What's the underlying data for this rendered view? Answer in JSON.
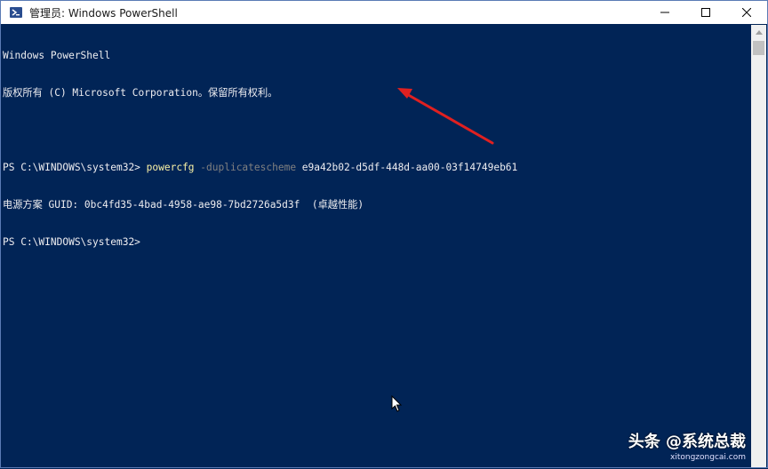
{
  "window": {
    "title": "管理员: Windows PowerShell"
  },
  "console": {
    "banner1": "Windows PowerShell",
    "banner2": "版权所有 (C) Microsoft Corporation。保留所有权利。",
    "prompt1": "PS C:\\WINDOWS\\system32> ",
    "cmd": "powercfg",
    "param": " -duplicatescheme",
    "arg": " e9a42b02-d5df-448d-aa00-03f14749eb61",
    "output": "电源方案 GUID: 0bc4fd35-4bad-4958-ae98-7bd2726a5d3f  (卓越性能)",
    "prompt2": "PS C:\\WINDOWS\\system32>"
  },
  "watermark": {
    "main": "头条 @系统总裁",
    "sub": "xitongzongcai.com"
  },
  "colors": {
    "console_bg": "#012456",
    "command": "#f9f1a5",
    "parameter": "#808080",
    "annotation_arrow": "#e02020"
  }
}
